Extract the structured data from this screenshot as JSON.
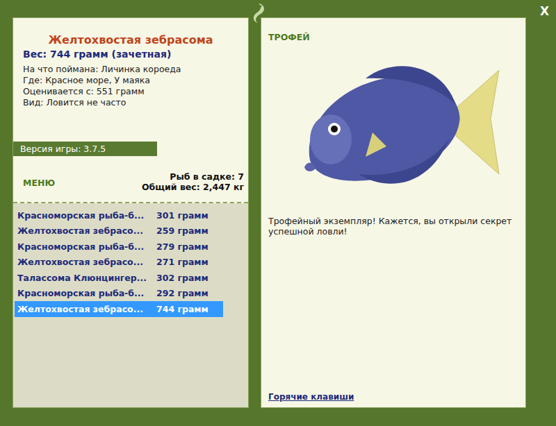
{
  "window": {
    "close": "X"
  },
  "fish": {
    "name": "Желтохвостая зебрасома",
    "weight": "Вес: 744 грамм (зачетная)",
    "details": [
      "На что поймана: Личинка короеда",
      "Где: Красное море, У маяка",
      "Оценивается с: 551 грамм",
      "Вид: Ловится не часто"
    ]
  },
  "version": "Версия игры: 3.7.5",
  "menu": "МЕНЮ",
  "keepnet": {
    "count": "Рыб в садке: 7",
    "total": "Общий вес: 2,447 кг"
  },
  "catch_list": [
    {
      "name": "Красноморская рыба-б...",
      "weight": "301 грамм",
      "selected": false
    },
    {
      "name": "Желтохвостая зебрасо...",
      "weight": "259 грамм",
      "selected": false
    },
    {
      "name": "Красноморская рыба-б...",
      "weight": "279 грамм",
      "selected": false
    },
    {
      "name": "Желтохвостая зебрасо...",
      "weight": "271 грамм",
      "selected": false
    },
    {
      "name": "Талассома Клюнцингер...",
      "weight": "302 грамм",
      "selected": false
    },
    {
      "name": "Красноморская рыба-б...",
      "weight": "292 грамм",
      "selected": false
    },
    {
      "name": "Желтохвостая зебрасо...",
      "weight": "744 грамм",
      "selected": true
    }
  ],
  "trophy": {
    "label": "ТРОФЕЙ",
    "message": "Трофейный экземпляр! Кажется, вы открыли секрет успешной ловли!",
    "hotkeys": "Горячие клавиши"
  }
}
